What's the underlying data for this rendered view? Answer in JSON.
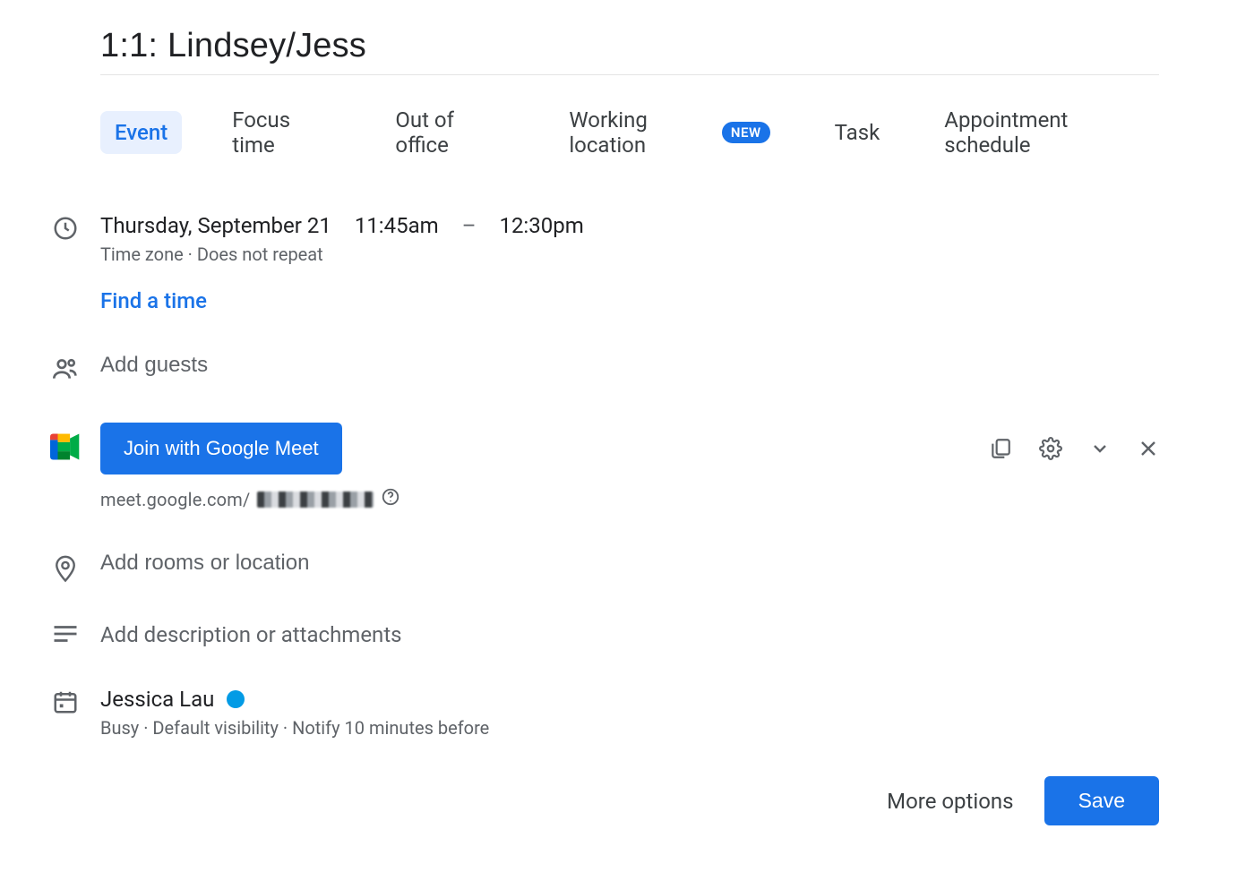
{
  "title": "1:1: Lindsey/Jess",
  "tabs": {
    "event": "Event",
    "focus": "Focus time",
    "ooo": "Out of office",
    "working_location": "Working location",
    "working_location_badge": "NEW",
    "task": "Task",
    "appointment": "Appointment schedule"
  },
  "time": {
    "date": "Thursday, September 21",
    "start": "11:45am",
    "dash": "–",
    "end": "12:30pm",
    "sub": "Time zone · Does not repeat"
  },
  "find_time": "Find a time",
  "guests_placeholder": "Add guests",
  "meet": {
    "button": "Join with Google Meet",
    "link_prefix": "meet.google.com/"
  },
  "location_placeholder": "Add rooms or location",
  "description_placeholder": "Add description or attachments",
  "calendar": {
    "name": "Jessica Lau",
    "sub": "Busy · Default visibility · Notify 10 minutes before"
  },
  "footer": {
    "more": "More options",
    "save": "Save"
  }
}
